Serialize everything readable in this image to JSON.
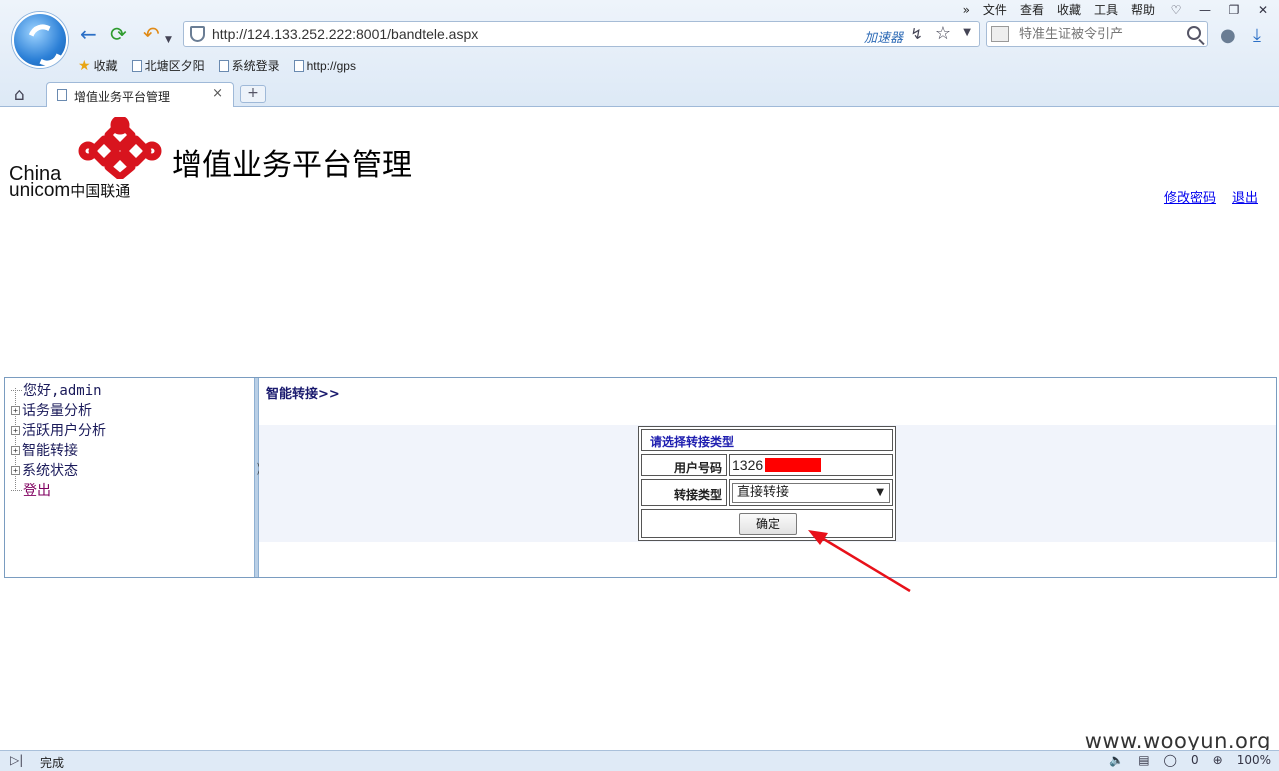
{
  "browser": {
    "menu": [
      "文件",
      "查看",
      "收藏",
      "工具",
      "帮助"
    ],
    "more_icon": "»",
    "address_url": "http://124.133.252.222:8001/bandtele.aspx",
    "accelerator_label": "加速器",
    "search_placeholder": "特准生证被令引产",
    "favorites": [
      "收藏",
      "北塘区夕阳",
      "系统登录",
      "http://gps"
    ],
    "tab_title": "增值业务平台管理",
    "tab_close": "×",
    "new_tab": "+",
    "status_text": "完成",
    "status_count": "0",
    "zoom": "100%"
  },
  "header": {
    "brand_latin_1": "China",
    "brand_latin_2": "unicom",
    "brand_cn": "中国联通",
    "page_title": "增值业务平台管理",
    "link_change_password": "修改密码",
    "link_logout": "退出"
  },
  "nav_tree": {
    "greeting": "您好,admin",
    "items": [
      "话务量分析",
      "活跃用户分析",
      "智能转接",
      "系统状态"
    ],
    "logout": "登出"
  },
  "main": {
    "breadcrumb": "智能转接>>",
    "form_title": "请选择转接类型",
    "user_number_label": "用户号码",
    "user_number_value": "1326",
    "transfer_type_label": "转接类型",
    "transfer_type_value": "直接转接",
    "confirm_button": "确定"
  },
  "watermark": "www.wooyun.org",
  "colors": {
    "annotation_arrow": "#e8111a",
    "redaction": "#ff0000",
    "unicom_red": "#d8141e"
  }
}
